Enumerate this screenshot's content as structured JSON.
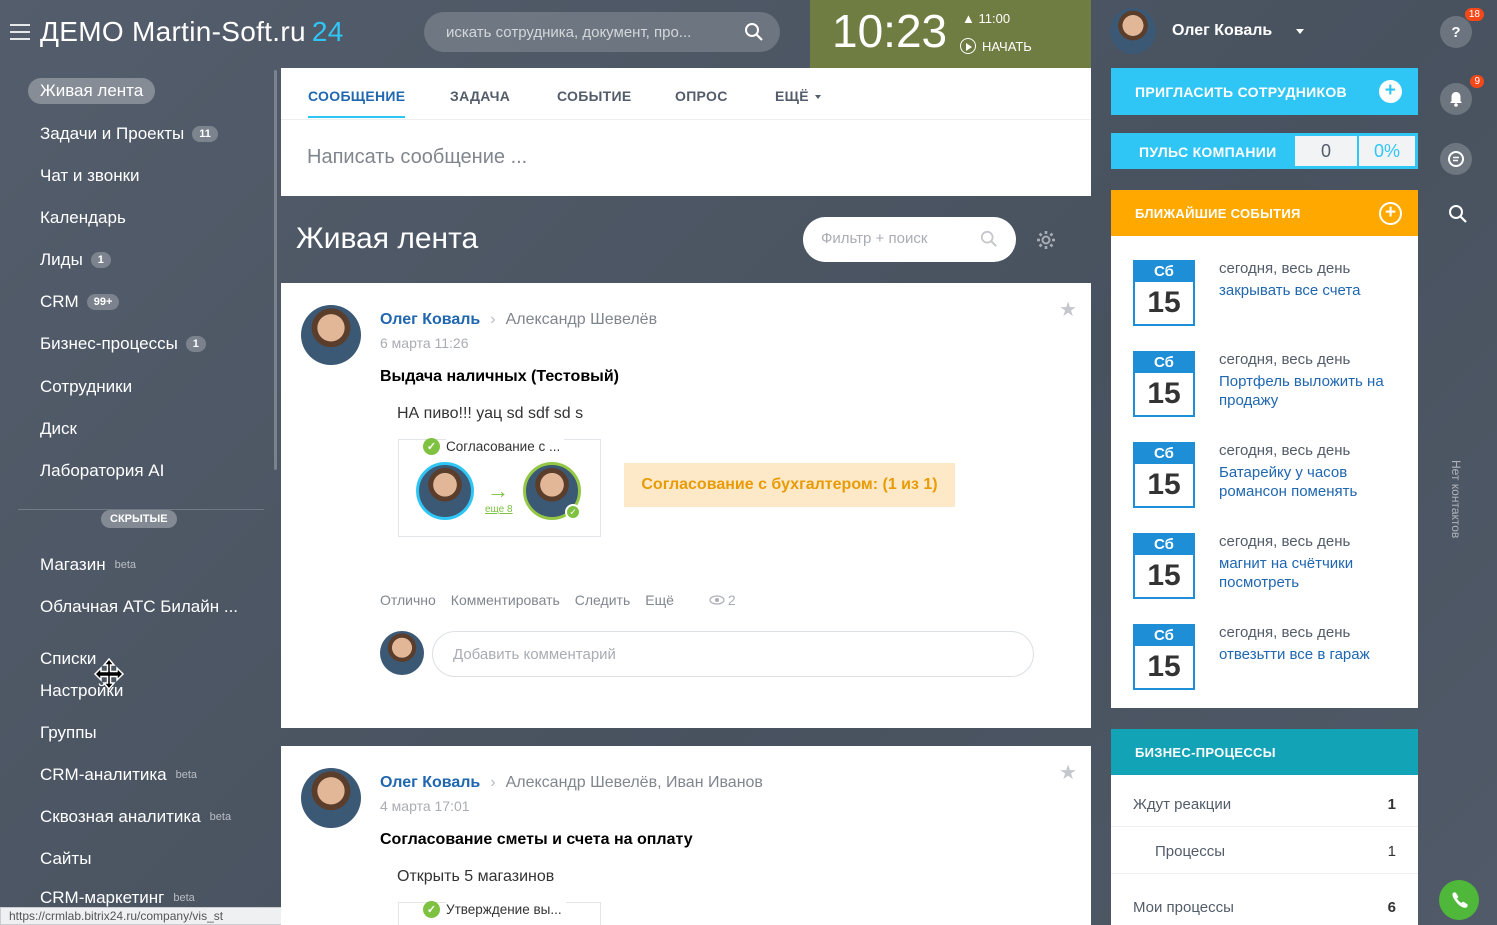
{
  "header": {
    "logo_text": "ДЕМО Martin-Soft.ru",
    "logo_num": "24",
    "search_placeholder": "искать сотрудника, документ, про...",
    "clock_time": "10:23",
    "alarm_time": "11:00",
    "start_label": "НАЧАТЬ",
    "user_name": "Олег Коваль",
    "help_badge": "18",
    "notif_badge": "9"
  },
  "sidebar": {
    "items": [
      {
        "label": "Живая лента",
        "count": ""
      },
      {
        "label": "Задачи и Проекты",
        "count": "11"
      },
      {
        "label": "Чат и звонки",
        "count": ""
      },
      {
        "label": "Календарь",
        "count": ""
      },
      {
        "label": "Лиды",
        "count": "1"
      },
      {
        "label": "CRM",
        "count": "99+"
      },
      {
        "label": "Бизнес-процессы",
        "count": "1"
      },
      {
        "label": "Сотрудники",
        "count": ""
      },
      {
        "label": "Диск",
        "count": ""
      },
      {
        "label": "Лаборатория AI",
        "count": ""
      }
    ],
    "hidden_label": "СКРЫТЫЕ",
    "hidden_items": [
      {
        "label": "Магазин",
        "beta": "beta"
      },
      {
        "label": "Облачная АТС Билайн ...",
        "beta": ""
      },
      {
        "label": "Списки",
        "beta": ""
      },
      {
        "label": "Настройки",
        "beta": ""
      },
      {
        "label": "Группы",
        "beta": ""
      },
      {
        "label": "CRM-аналитика",
        "beta": "beta"
      },
      {
        "label": "Сквозная аналитика",
        "beta": "beta"
      },
      {
        "label": "Сайты",
        "beta": ""
      },
      {
        "label": "CRM-маркетинг",
        "beta": "beta"
      }
    ],
    "status_url": "https://crmlab.bitrix24.ru/company/vis_st"
  },
  "composer": {
    "tabs": [
      "СООБЩЕНИЕ",
      "ЗАДАЧА",
      "СОБЫТИЕ",
      "ОПРОС",
      "ЕЩЁ"
    ],
    "placeholder": "Написать сообщение ..."
  },
  "feed": {
    "title": "Живая лента",
    "filter_placeholder": "Фильтр + поиск"
  },
  "posts": [
    {
      "author": "Олег Коваль",
      "recipients": "Александр Шевелёв",
      "date": "6 марта 11:26",
      "title": "Выдача наличных (Тестовый)",
      "body": "НА пиво!!! уац sd sdf sd s",
      "bp_title": "Согласование с ...",
      "bp_more": "еще 8",
      "bp_status": "Согласование с бухгалтером: (1 из 1)",
      "actions": [
        "Отлично",
        "Комментировать",
        "Следить",
        "Ещё"
      ],
      "views": "2",
      "comment_placeholder": "Добавить комментарий"
    },
    {
      "author": "Олег Коваль",
      "recipients": "Александр Шевелёв, Иван Иванов",
      "date": "4 марта 17:01",
      "title": "Согласование сметы и счета на оплату",
      "body": "Открыть 5 магазинов",
      "bp_title": "Утверждение вы..."
    }
  ],
  "right": {
    "invite_label": "ПРИГЛАСИТЬ СОТРУДНИКОВ",
    "pulse_label": "ПУЛЬС КОМПАНИИ",
    "pulse_value": "0",
    "pulse_percent": "0%",
    "events_label": "БЛИЖАЙШИЕ СОБЫТИЯ",
    "events": [
      {
        "dow": "Сб",
        "day": "15",
        "when": "сегодня, весь день",
        "what": "закрывать все счета"
      },
      {
        "dow": "Сб",
        "day": "15",
        "when": "сегодня, весь день",
        "what": "Портфель выложить на продажу"
      },
      {
        "dow": "Сб",
        "day": "15",
        "when": "сегодня, весь день",
        "what": "Батарейку у часов романсон поменять"
      },
      {
        "dow": "Сб",
        "day": "15",
        "when": "сегодня, весь день",
        "what": "магнит на счётчики посмотреть"
      },
      {
        "dow": "Сб",
        "day": "15",
        "when": "сегодня, весь день",
        "what": "отвезьтти все в гараж"
      }
    ],
    "bp_label": "БИЗНЕС-ПРОЦЕССЫ",
    "bp_rows": [
      {
        "label": "Ждут реакции",
        "value": "1"
      },
      {
        "label": "Процессы",
        "value": "1"
      },
      {
        "label": "Мои процессы",
        "value": "6"
      }
    ],
    "no_contacts": "Нет контактов"
  },
  "colors": {
    "accent": "#2fc6f6",
    "events": "#ffa900",
    "bp": "#12a3b6",
    "clock": "#6f7c42"
  }
}
